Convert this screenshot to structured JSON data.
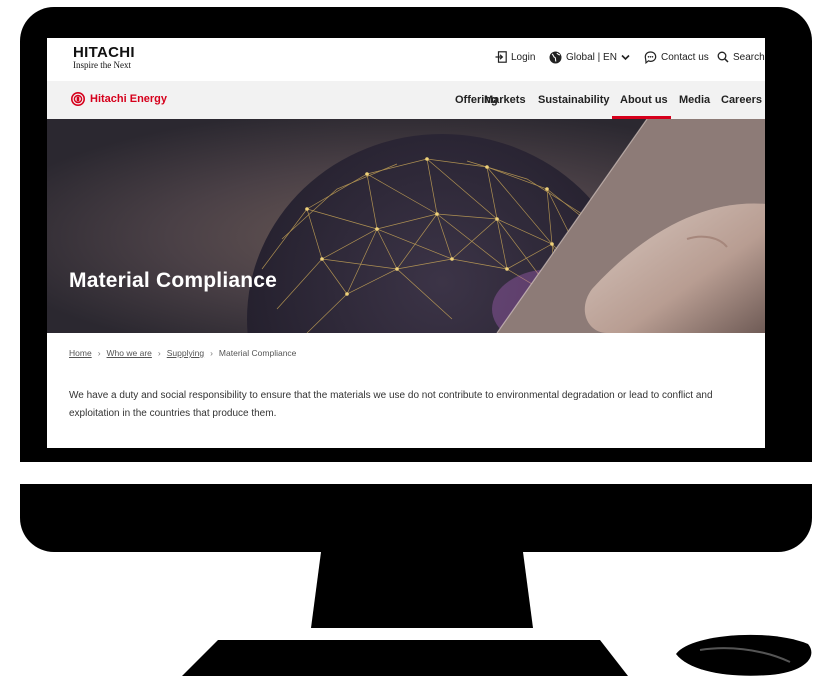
{
  "header": {
    "brand_name": "HITACHI",
    "brand_tagline": "Inspire the Next",
    "login_label": "Login",
    "region_label": "Global | EN",
    "contact_label": "Contact us",
    "search_label": "Search"
  },
  "nav": {
    "logo_text": "Hitachi Energy",
    "items": [
      "Offering",
      "Markets",
      "Sustainability",
      "About us",
      "Media",
      "Careers"
    ],
    "active_item": "About us",
    "accent_color": "#d6001c"
  },
  "hero": {
    "title": "Material Compliance"
  },
  "breadcrumb": {
    "items": [
      "Home",
      "Who we are",
      "Supplying"
    ],
    "current": "Material Compliance"
  },
  "intro": {
    "text": "We have a duty and social responsibility to ensure that the materials we use do not contribute to environmental degradation or lead to conflict and exploitation in the countries that produce them."
  }
}
